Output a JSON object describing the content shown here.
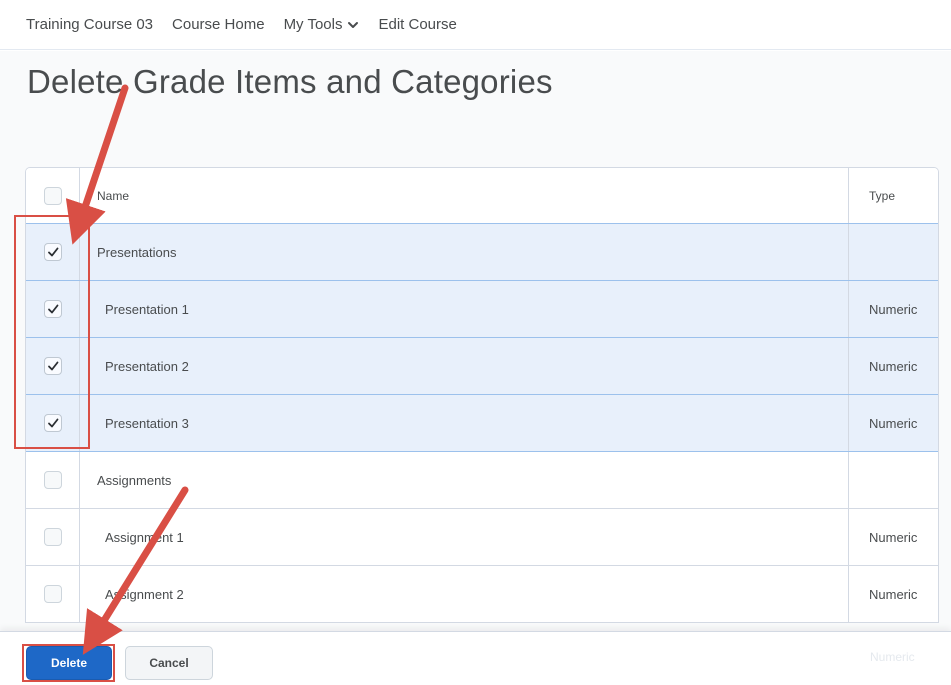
{
  "nav": {
    "items": [
      "Training Course 03",
      "Course Home",
      "My Tools",
      "Edit Course"
    ]
  },
  "page": {
    "title": "Delete Grade Items and Categories"
  },
  "table": {
    "headers": {
      "name": "Name",
      "type": "Type"
    },
    "rows": [
      {
        "name": "Presentations",
        "type": "",
        "checked": true,
        "indent": false
      },
      {
        "name": "Presentation 1",
        "type": "Numeric",
        "checked": true,
        "indent": true
      },
      {
        "name": "Presentation 2",
        "type": "Numeric",
        "checked": true,
        "indent": true
      },
      {
        "name": "Presentation 3",
        "type": "Numeric",
        "checked": true,
        "indent": true
      },
      {
        "name": "Assignments",
        "type": "",
        "checked": false,
        "indent": false
      },
      {
        "name": "Assignment 1",
        "type": "Numeric",
        "checked": false,
        "indent": true
      },
      {
        "name": "Assignment 2",
        "type": "Numeric",
        "checked": false,
        "indent": true
      }
    ],
    "hidden_row_type": "Numeric"
  },
  "footer": {
    "delete_label": "Delete",
    "cancel_label": "Cancel"
  },
  "colors": {
    "primary": "#1e68c7",
    "annotation": "#d94f45",
    "selected_row": "#e8f0fb"
  }
}
